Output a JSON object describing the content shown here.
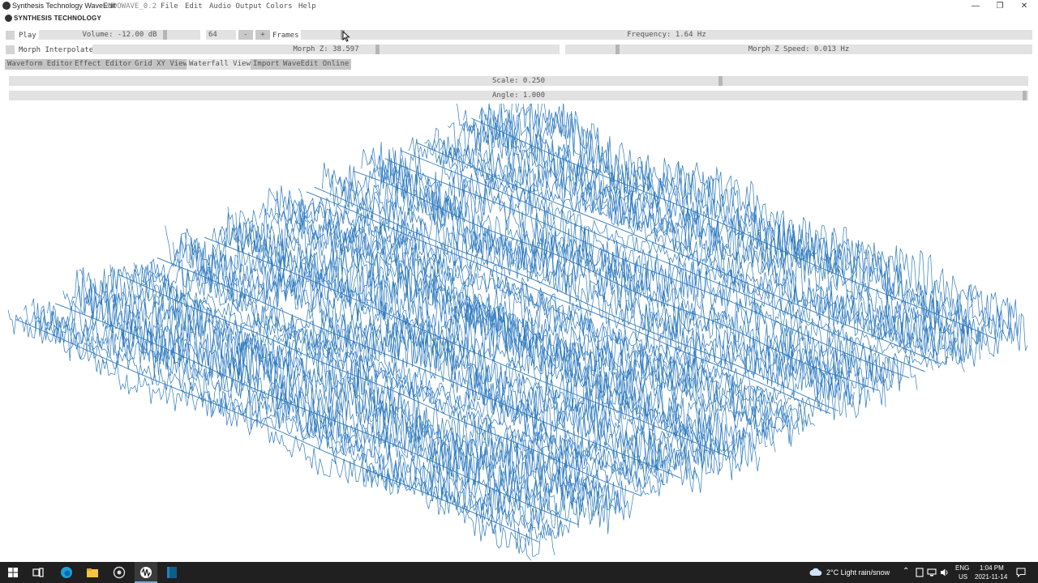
{
  "window": {
    "title": "Synthesis Technology WaveEdit"
  },
  "menubar": {
    "brand": "SYNTHESIS TECHNOLOGY",
    "version": "vMOOWAVE_0.2",
    "items": [
      "File",
      "Edit",
      "Audio Output",
      "Colors",
      "Help"
    ]
  },
  "controls": {
    "play_label": "Play",
    "volume": "Volume: -12.00 dB",
    "frames_count": "64",
    "minus": "-",
    "plus": "+",
    "frames_label": "Frames",
    "frequency": "Frequency: 1.64 Hz",
    "morph_interpolate_label": "Morph Interpolate",
    "morph_z": "Morph Z: 38.597",
    "morph_z_speed": "Morph Z Speed: 0.013 Hz"
  },
  "tabs": [
    "Waveform Editor",
    "Effect Editor",
    "Grid XY View",
    "Waterfall View",
    "Import",
    "WaveEdit Online"
  ],
  "active_tab": "Waterfall View",
  "view": {
    "scale": "Scale: 0.250",
    "angle": "Angle: 1.000"
  },
  "taskbar": {
    "weather": "2°C  Light rain/snow",
    "lang": "ENG",
    "region": "US",
    "time": "1:04 PM",
    "date": "2021-11-14"
  },
  "colors": {
    "waveform": "#2f7bbf",
    "taskbar": "#202020"
  }
}
